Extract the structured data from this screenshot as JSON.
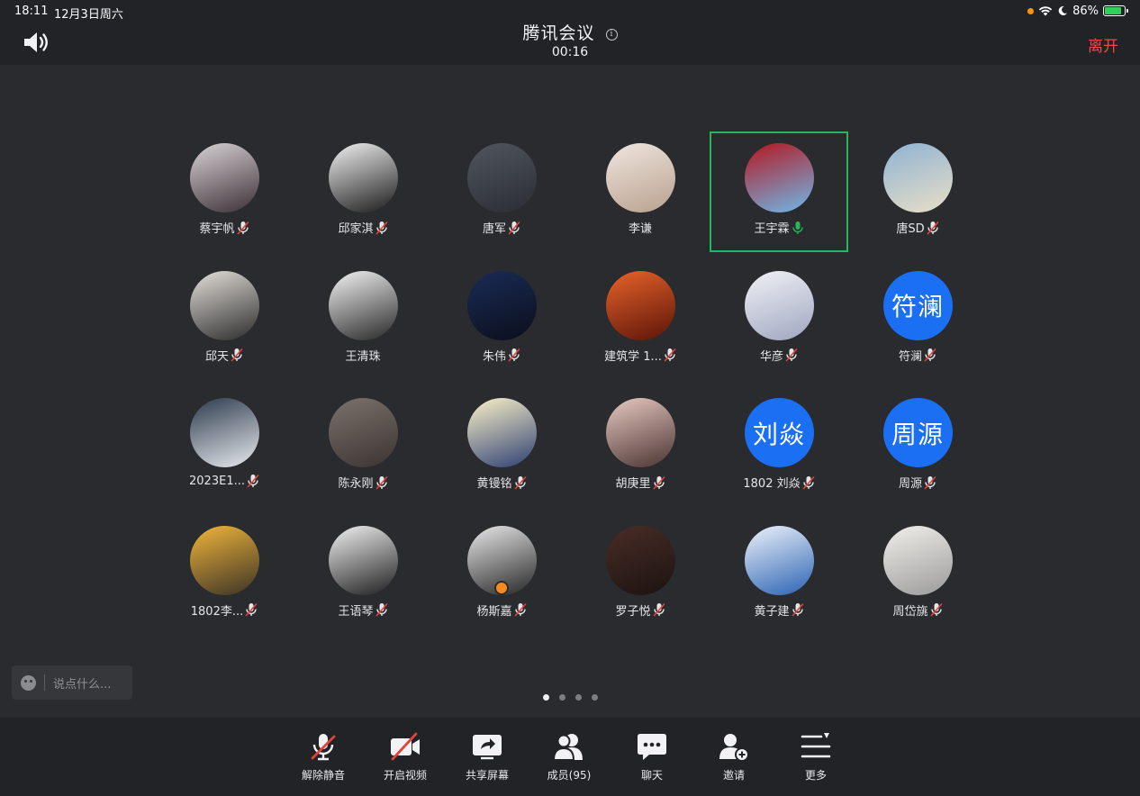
{
  "status_bar": {
    "time": "18:11",
    "date": "12月3日周六",
    "battery_percent": "86%"
  },
  "header": {
    "title": "腾讯会议",
    "duration": "00:16",
    "leave_label": "离开"
  },
  "participants": [
    {
      "name": "蔡宇帆",
      "mic": "muted",
      "avatar_text": "",
      "colors": [
        "#d9d3d6",
        "#3b3035"
      ]
    },
    {
      "name": "邱家淇",
      "mic": "muted",
      "avatar_text": "",
      "colors": [
        "#f2f2f2",
        "#1a1a1a"
      ]
    },
    {
      "name": "唐军",
      "mic": "muted",
      "avatar_text": "",
      "colors": [
        "#51565e",
        "#2a2d33"
      ]
    },
    {
      "name": "李谦",
      "mic": "none",
      "avatar_text": "",
      "colors": [
        "#efe6df",
        "#b9a08e"
      ]
    },
    {
      "name": "王宇霖",
      "mic": "active",
      "avatar_text": "",
      "colors": [
        "#b5161f",
        "#6fb9ea"
      ],
      "active": true
    },
    {
      "name": "唐SD",
      "mic": "muted",
      "avatar_text": "",
      "colors": [
        "#8fb2d3",
        "#e8dfc6"
      ]
    },
    {
      "name": "邱天",
      "mic": "muted",
      "avatar_text": "",
      "colors": [
        "#e4e0da",
        "#2b2b2b"
      ]
    },
    {
      "name": "王清珠",
      "mic": "none",
      "avatar_text": "",
      "colors": [
        "#f4f4f4",
        "#262626"
      ]
    },
    {
      "name": "朱伟",
      "mic": "muted",
      "avatar_text": "",
      "colors": [
        "#1a2b55",
        "#0b0f1c"
      ]
    },
    {
      "name": "建筑学 1...",
      "mic": "muted",
      "avatar_text": "",
      "colors": [
        "#e8632b",
        "#5a1408"
      ]
    },
    {
      "name": "华彦",
      "mic": "muted",
      "avatar_text": "",
      "colors": [
        "#f1f2f6",
        "#9ea5bf"
      ]
    },
    {
      "name": "符澜",
      "mic": "muted",
      "avatar_text": "符澜",
      "colors": [
        "#1a6ff2",
        "#1a6ff2"
      ]
    },
    {
      "name": "2023E1...",
      "mic": "muted",
      "avatar_text": "",
      "colors": [
        "#2c3a4c",
        "#e8ebef"
      ]
    },
    {
      "name": "陈永刚",
      "mic": "muted",
      "avatar_text": "",
      "colors": [
        "#7d726c",
        "#3a3432"
      ]
    },
    {
      "name": "黄镘铭",
      "mic": "muted",
      "avatar_text": "",
      "colors": [
        "#fbf3c9",
        "#2e3f73"
      ]
    },
    {
      "name": "胡庚里",
      "mic": "muted",
      "avatar_text": "",
      "colors": [
        "#e7c9c1",
        "#4a3432"
      ]
    },
    {
      "name": "1802 刘焱",
      "mic": "muted",
      "avatar_text": "刘焱",
      "colors": [
        "#1a6ff2",
        "#1a6ff2"
      ]
    },
    {
      "name": "周源",
      "mic": "muted",
      "avatar_text": "周源",
      "colors": [
        "#1a6ff2",
        "#1a6ff2"
      ]
    },
    {
      "name": "1802李...",
      "mic": "muted",
      "avatar_text": "",
      "colors": [
        "#f0b63a",
        "#3b3226"
      ]
    },
    {
      "name": "王语琴",
      "mic": "muted",
      "avatar_text": "",
      "colors": [
        "#f2f2f2",
        "#1d1d1d"
      ]
    },
    {
      "name": "杨斯嘉",
      "mic": "muted",
      "avatar_text": "",
      "colors": [
        "#e9e9ea",
        "#252525"
      ],
      "host": true
    },
    {
      "name": "罗子悦",
      "mic": "muted",
      "avatar_text": "",
      "colors": [
        "#4a2d26",
        "#1b1311"
      ]
    },
    {
      "name": "黄子建",
      "mic": "muted",
      "avatar_text": "",
      "colors": [
        "#eef3fa",
        "#2a62b3"
      ]
    },
    {
      "name": "周岱旐",
      "mic": "muted",
      "avatar_text": "",
      "colors": [
        "#f1efea",
        "#9a9a9a"
      ]
    }
  ],
  "pager": {
    "total": 4,
    "current": 1
  },
  "chat": {
    "placeholder": "说点什么..."
  },
  "toolbar": {
    "unmute": "解除静音",
    "video": "开启视频",
    "share": "共享屏幕",
    "members": "成员(95)",
    "chat": "聊天",
    "invite": "邀请",
    "more": "更多"
  },
  "colors": {
    "background": "#2a2b2f",
    "bar": "#222326",
    "accent_blue": "#1a6ff2",
    "leave_red": "#f04a4a",
    "speaking_green": "#2bb45e",
    "mute_red": "#e0433a"
  }
}
